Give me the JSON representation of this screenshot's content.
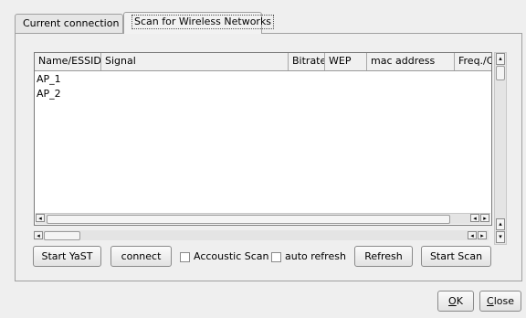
{
  "tabs": [
    {
      "label": "Current connection"
    },
    {
      "label": "Scan for Wireless Networks"
    }
  ],
  "table": {
    "columns": [
      "Name/ESSID",
      "Signal",
      "Bitrate",
      "WEP",
      "mac address",
      "Freq./C"
    ],
    "rows": [
      [
        "AP_1",
        "",
        "",
        "",
        "",
        ""
      ],
      [
        "AP_2",
        "",
        "",
        "",
        "",
        ""
      ]
    ]
  },
  "buttons": {
    "start_yast": "Start YaST",
    "connect": "connect",
    "refresh": "Refresh",
    "start_scan": "Start Scan"
  },
  "checkboxes": {
    "accoustic_scan": {
      "label": "Accoustic Scan",
      "checked": false
    },
    "auto_refresh": {
      "label": "auto refresh",
      "checked": false
    }
  },
  "dialog": {
    "ok_key": "O",
    "ok_rest": "K",
    "close_key": "C",
    "close_rest": "lose"
  },
  "icons": {
    "arrow_left": "◂",
    "arrow_right": "▸",
    "arrow_up": "▴",
    "arrow_down": "▾"
  }
}
